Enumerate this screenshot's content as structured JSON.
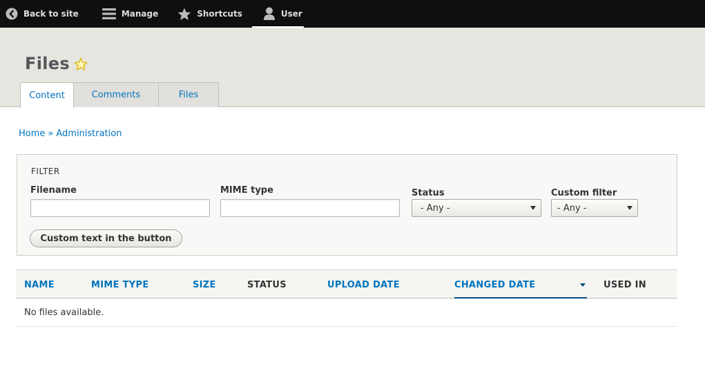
{
  "toolbar": {
    "back_to_site": "Back to site",
    "manage": "Manage",
    "shortcuts": "Shortcuts",
    "user": "User"
  },
  "header": {
    "title": "Files",
    "tabs": [
      {
        "label": "Content",
        "active": true
      },
      {
        "label": "Comments",
        "active": false
      },
      {
        "label": "Files",
        "active": false
      }
    ]
  },
  "breadcrumb": {
    "items": [
      "Home",
      "Administration"
    ],
    "separator": "»"
  },
  "filter": {
    "legend": "FILTER",
    "filename_label": "Filename",
    "filename_value": "",
    "mime_label": "MIME type",
    "mime_value": "",
    "status_label": "Status",
    "status_selected": "- Any -",
    "custom_label": "Custom filter",
    "custom_selected": "- Any -",
    "button_label": "Custom text in the button"
  },
  "table": {
    "columns": [
      "NAME",
      "MIME TYPE",
      "SIZE",
      "STATUS",
      "UPLOAD DATE",
      "CHANGED DATE",
      "USED IN"
    ],
    "empty_message": "No files available."
  },
  "colors": {
    "link": "#0074bd",
    "toolbar_bg": "#0f0f0f",
    "header_bg": "#e6e5e0",
    "star": "#e3c200"
  }
}
